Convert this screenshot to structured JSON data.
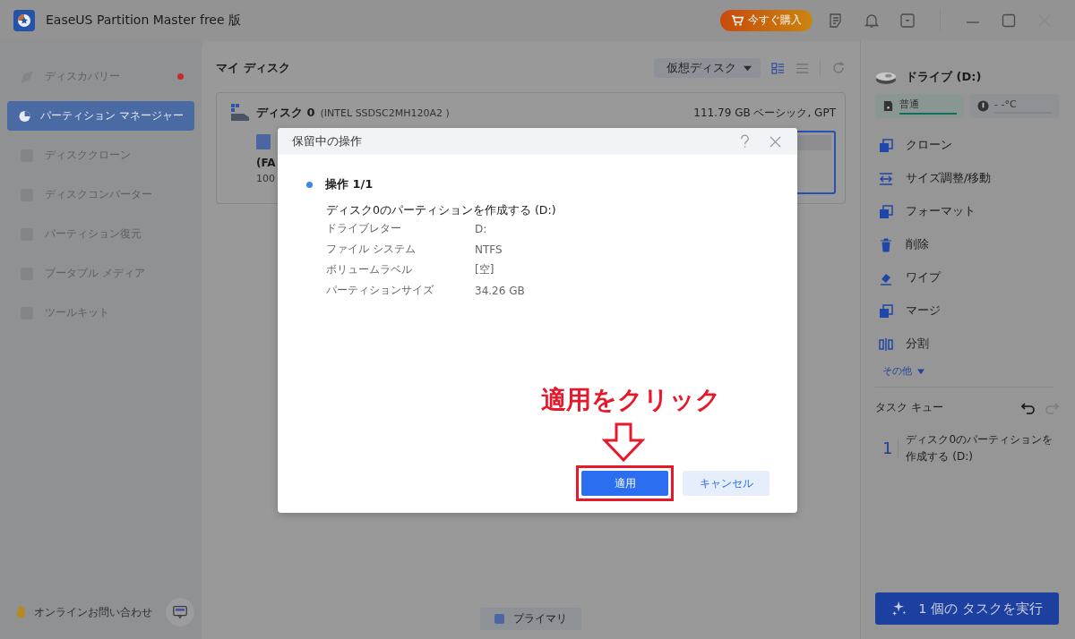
{
  "window": {
    "title": "EaseUS Partition Master free 版",
    "buy_button": "今すぐ購入"
  },
  "sidebar": {
    "items": [
      {
        "label": "ディスカバリー",
        "selected": false,
        "notification": true
      },
      {
        "label": "パーティション マネージャー",
        "selected": true,
        "notification": false
      },
      {
        "label": "ディスククローン",
        "selected": false,
        "notification": false
      },
      {
        "label": "ディスクコンバーター",
        "selected": false,
        "notification": false
      },
      {
        "label": "パーティション復元",
        "selected": false,
        "notification": false
      },
      {
        "label": "ブータブル メディア",
        "selected": false,
        "notification": false
      },
      {
        "label": "ツールキット",
        "selected": false,
        "notification": false
      }
    ],
    "contact": "オンラインお問い合わせ"
  },
  "main": {
    "title": "マイ ディスク",
    "view_dropdown": "仮想ディスク",
    "disk": {
      "name": "ディスク 0",
      "model": "(INTEL SSDSC2MH120A2 )",
      "info": "111.79 GB ベーシック, GPT",
      "partitions": [
        {
          "label": "(FA",
          "size": "100",
          "selected": false
        },
        {
          "selected": true
        }
      ]
    },
    "legend": [
      {
        "label": "プライマリ",
        "color": "#4b67a3"
      }
    ]
  },
  "dialog": {
    "title": "保留中の操作",
    "operation_heading": "操作 1/1",
    "description": "ディスク0のパーティションを作成する (D:)",
    "details": [
      {
        "label": "ドライブレター",
        "value": "D:"
      },
      {
        "label": "ファイル システム",
        "value": "NTFS"
      },
      {
        "label": "ボリュームラベル",
        "value": "[空]"
      },
      {
        "label": "パーティションサイズ",
        "value": "34.26 GB"
      }
    ],
    "buttons": [
      {
        "label": "適用",
        "kind": "primary"
      },
      {
        "label": "キャンセル",
        "kind": "secondary"
      }
    ]
  },
  "annotation": {
    "text": "適用をクリック"
  },
  "right_panel": {
    "drive": "ドライブ (D:)",
    "health": {
      "label": "普通",
      "level": 1
    },
    "temperature": {
      "label": "- -°C"
    },
    "actions": [
      "クローン",
      "サイズ調整/移動",
      "フォーマット",
      "削除",
      "ワイプ",
      "マージ",
      "分割"
    ],
    "more": "その他",
    "task_queue": {
      "title": "タスク キュー",
      "tasks": [
        {
          "number": "1",
          "text": "ディスク0のパーティションを作成する (D:)"
        }
      ]
    },
    "run_button": "1 個の タスクを実行"
  }
}
